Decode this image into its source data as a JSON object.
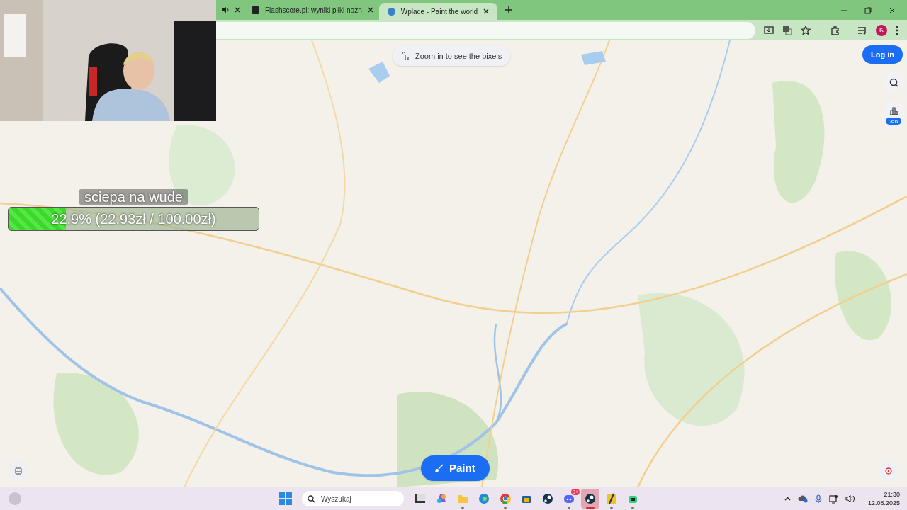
{
  "browser": {
    "tabs": [
      {
        "audio": true,
        "selected": false
      },
      {
        "audio": false,
        "title": "Flashscore.pl: wyniki piłki nożn",
        "selected": false
      },
      {
        "audio": false,
        "title": "Wplace - Paint the world",
        "selected": true
      }
    ],
    "profile_initial": "K"
  },
  "page": {
    "map_hint": "Zoom in to see the pixels",
    "login_button": "Log in",
    "side_tools": [
      {
        "kind": "search"
      },
      {
        "kind": "stats",
        "badge": "new"
      }
    ],
    "paint_button": "Paint"
  },
  "donation": {
    "title": "sciepa na wude",
    "level": 0.229,
    "reading": "22.9% (22.93zł / 100.00zł)"
  },
  "taskbar": {
    "search_placeholder": "Wyszukaj",
    "apps": [
      {
        "kind": "desktop",
        "running": false,
        "selected": false
      },
      {
        "kind": "copilot",
        "running": false,
        "selected": false
      },
      {
        "kind": "folder",
        "running": true,
        "selected": false
      },
      {
        "kind": "edge",
        "running": false,
        "selected": false
      },
      {
        "kind": "chrome",
        "running": true,
        "selected": false
      },
      {
        "kind": "store",
        "running": false,
        "selected": false
      },
      {
        "kind": "steam",
        "running": false,
        "selected": false
      },
      {
        "kind": "discord",
        "running": true,
        "selected": false,
        "badge": "9+"
      },
      {
        "kind": "steam",
        "running": true,
        "selected": true
      },
      {
        "kind": "game",
        "running": true,
        "selected": false
      },
      {
        "kind": "bot",
        "running": true,
        "selected": false
      }
    ],
    "time": "21:30",
    "date": "12.08.2025"
  }
}
